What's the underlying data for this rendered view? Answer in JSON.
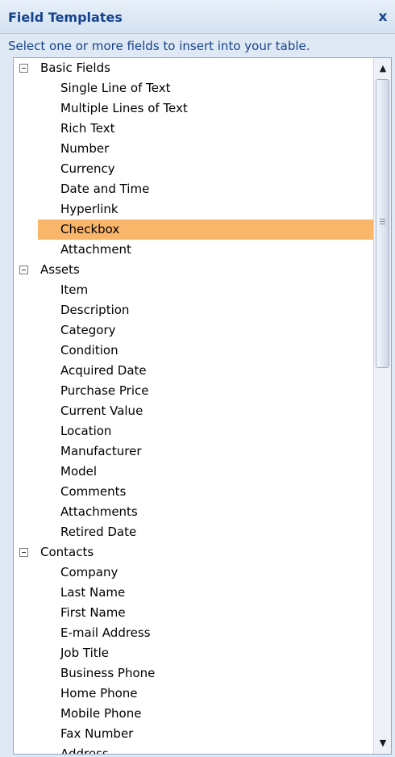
{
  "panel": {
    "title": "Field Templates",
    "close_label": "x",
    "instructions": "Select one or more fields to insert into your table."
  },
  "groups": [
    {
      "label": "Basic Fields",
      "expander": "minus",
      "items": [
        {
          "label": "Single Line of Text"
        },
        {
          "label": "Multiple Lines of Text"
        },
        {
          "label": "Rich Text"
        },
        {
          "label": "Number"
        },
        {
          "label": "Currency"
        },
        {
          "label": "Date and Time"
        },
        {
          "label": "Hyperlink"
        },
        {
          "label": "Checkbox",
          "selected": true
        },
        {
          "label": "Attachment"
        }
      ]
    },
    {
      "label": "Assets",
      "expander": "minus",
      "items": [
        {
          "label": "Item"
        },
        {
          "label": "Description"
        },
        {
          "label": "Category"
        },
        {
          "label": "Condition"
        },
        {
          "label": "Acquired Date"
        },
        {
          "label": "Purchase Price"
        },
        {
          "label": "Current Value"
        },
        {
          "label": "Location"
        },
        {
          "label": "Manufacturer"
        },
        {
          "label": "Model"
        },
        {
          "label": "Comments"
        },
        {
          "label": "Attachments"
        },
        {
          "label": "Retired Date"
        }
      ]
    },
    {
      "label": "Contacts",
      "expander": "minus",
      "items": [
        {
          "label": "Company"
        },
        {
          "label": "Last Name"
        },
        {
          "label": "First Name"
        },
        {
          "label": "E-mail Address"
        },
        {
          "label": "Job Title"
        },
        {
          "label": "Business Phone"
        },
        {
          "label": "Home Phone"
        },
        {
          "label": "Mobile Phone"
        },
        {
          "label": "Fax Number"
        },
        {
          "label": "Address"
        }
      ]
    }
  ],
  "colors": {
    "title_text": "#15428b",
    "selection": "#f9b56a",
    "panel_background": "#dfe9f5"
  },
  "icons": {
    "close": "close-icon",
    "expander": "collapse-icon",
    "scroll_up": "arrow-up-icon",
    "scroll_down": "arrow-down-icon"
  }
}
